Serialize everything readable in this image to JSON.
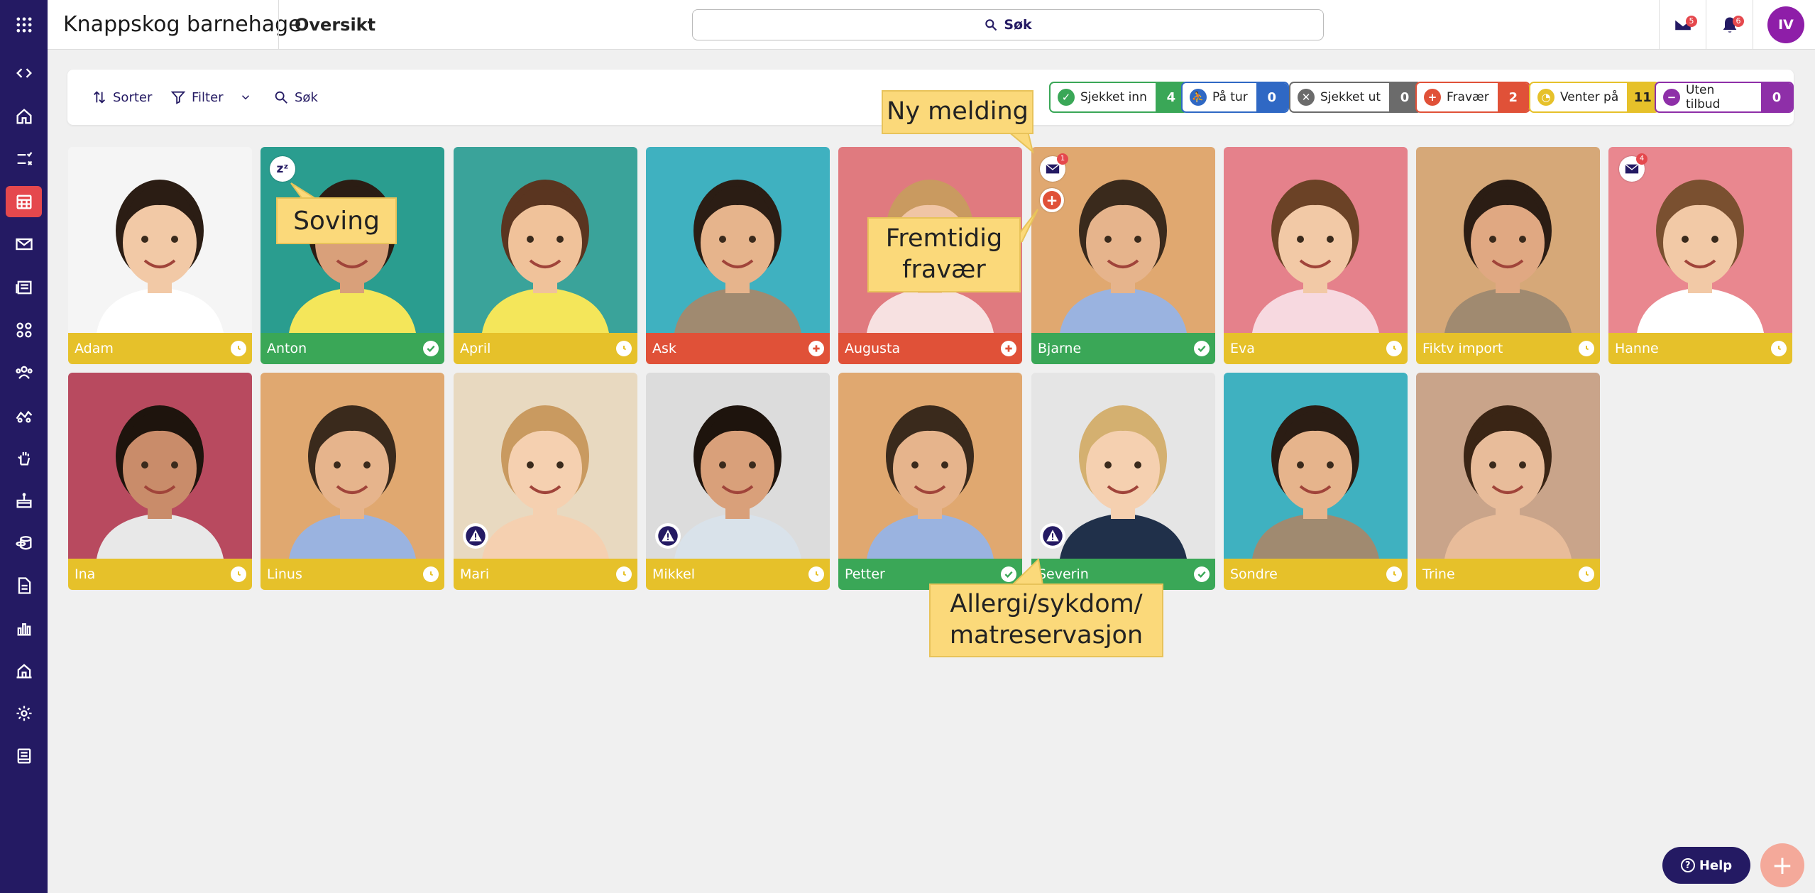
{
  "header": {
    "org_name": "Knappskog barnehage",
    "page_title": "Oversikt",
    "search_label": "Søk",
    "messages_badge": "5",
    "notifications_badge": "6",
    "avatar_initials": "IV"
  },
  "toolbar": {
    "sort_label": "Sorter",
    "filter_label": "Filter",
    "search_label": "Søk"
  },
  "statuses": [
    {
      "label": "Sjekket inn",
      "count": "4",
      "color": "#3aa757"
    },
    {
      "label": "På tur",
      "count": "0",
      "color": "#2f68c4"
    },
    {
      "label": "Sjekket ut",
      "count": "0",
      "color": "#6b6b6b"
    },
    {
      "label": "Fravær",
      "count": "2",
      "color": "#e05138"
    },
    {
      "label": "Venter på",
      "count": "11",
      "color": "#e6c12a"
    },
    {
      "label": "Uten tilbud",
      "count": "0",
      "color": "#8e2fa8"
    }
  ],
  "children": [
    {
      "name": "Adam",
      "status": "waiting"
    },
    {
      "name": "Anton",
      "status": "checked-in"
    },
    {
      "name": "April",
      "status": "waiting"
    },
    {
      "name": "Ask",
      "status": "absent"
    },
    {
      "name": "Augusta",
      "status": "absent"
    },
    {
      "name": "Bjarne",
      "status": "checked-in"
    },
    {
      "name": "Eva",
      "status": "waiting"
    },
    {
      "name": "Fiktv import",
      "status": "waiting"
    },
    {
      "name": "Hanne",
      "status": "waiting"
    },
    {
      "name": "Ina",
      "status": "waiting"
    },
    {
      "name": "Linus",
      "status": "waiting"
    },
    {
      "name": "Mari",
      "status": "waiting"
    },
    {
      "name": "Mikkel",
      "status": "waiting"
    },
    {
      "name": "Petter",
      "status": "checked-in"
    },
    {
      "name": "Severin",
      "status": "checked-in"
    },
    {
      "name": "Sondre",
      "status": "waiting"
    },
    {
      "name": "Trine",
      "status": "waiting"
    }
  ],
  "badges": {
    "bjarne_messages": "1",
    "hanne_messages": "4"
  },
  "callouts": {
    "sleeping": "Soving",
    "new_message": "Ny melding",
    "future_absence_1": "Fremtidig",
    "future_absence_2": "fravær",
    "allergy_1": "Allergi/sykdom/",
    "allergy_2": "matreservasjon"
  },
  "help_label": "Help",
  "colors": {
    "sidebar": "#241a63",
    "waiting": "#e6c12a",
    "checked_in": "#3aa757",
    "absent": "#e05138",
    "accent": "#e5484d"
  }
}
